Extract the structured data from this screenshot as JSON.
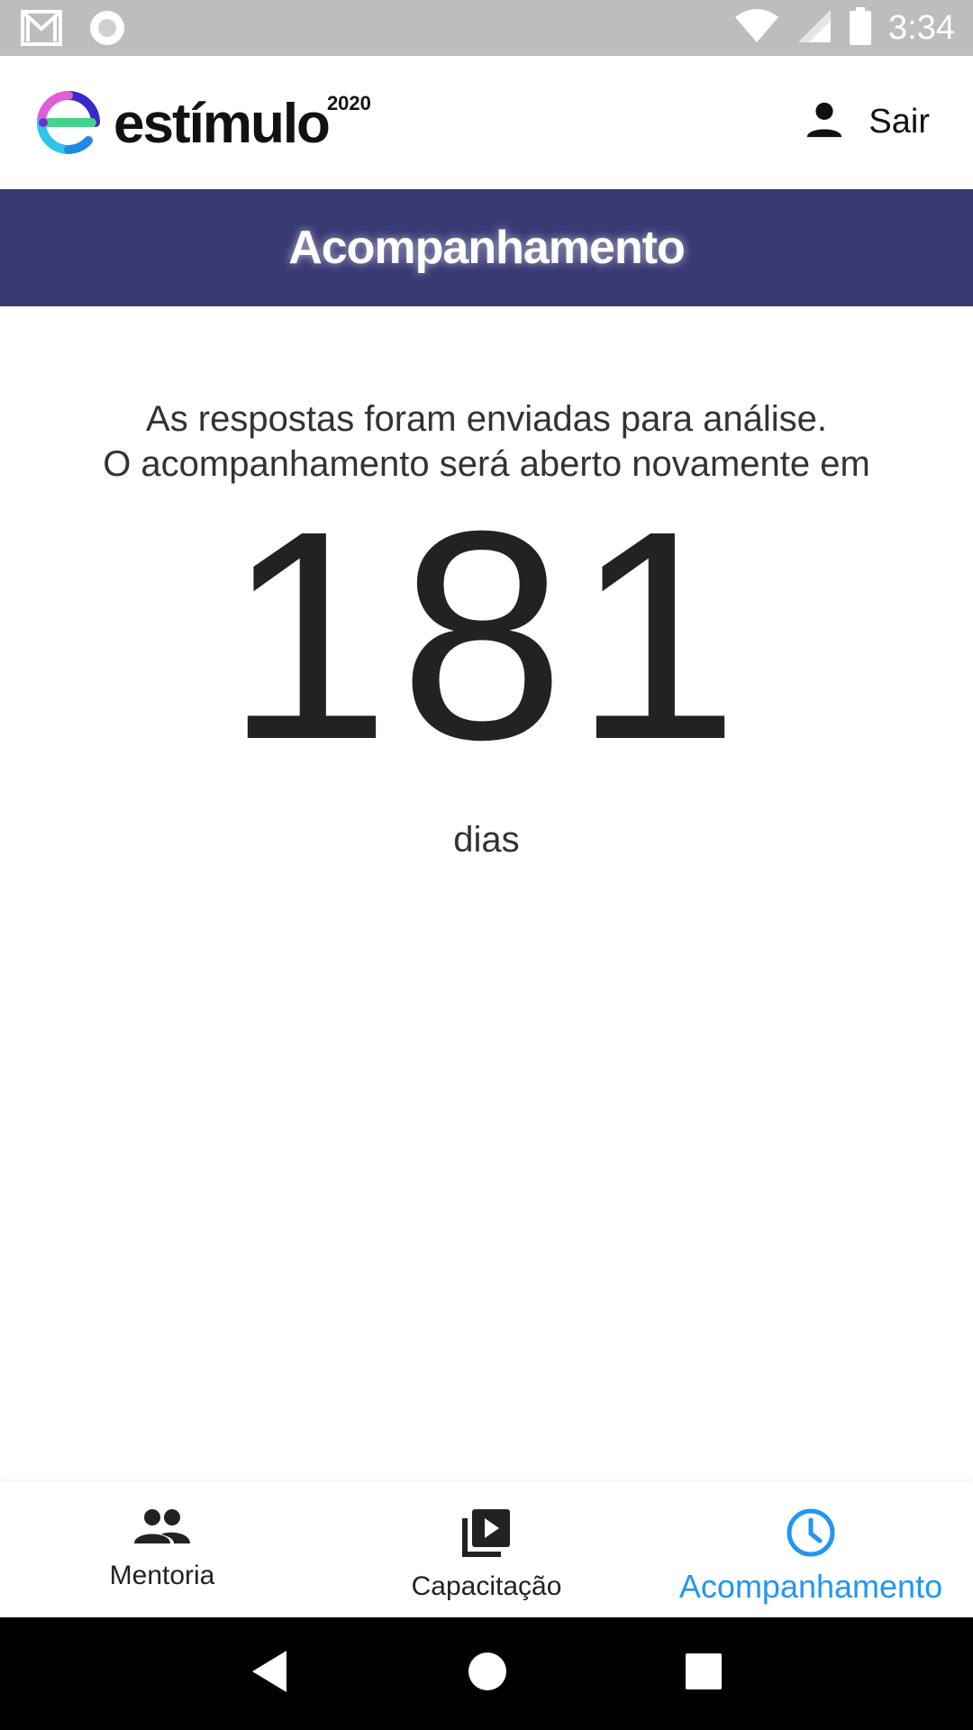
{
  "status_bar": {
    "time": "3:34",
    "icons": [
      "gmail-icon",
      "record-icon",
      "wifi-icon",
      "signal-icon",
      "battery-icon"
    ]
  },
  "header": {
    "logo_text": "estímulo",
    "logo_year": "2020",
    "logout_label": "Sair",
    "user_icon": "person-icon"
  },
  "banner": {
    "title": "Acompanhamento",
    "color": "#383a75"
  },
  "main": {
    "message_line1": "As respostas foram enviadas para análise.",
    "message_line2": "O acompanhamento será aberto novamente em",
    "countdown": "181",
    "unit": "dias"
  },
  "bottom_nav": {
    "active_color": "#2196f3",
    "items": [
      {
        "label": "Mentoria",
        "icon": "people-icon",
        "active": false
      },
      {
        "label": "Capacitação",
        "icon": "video-library-icon",
        "active": false
      },
      {
        "label": "Acompanhamento",
        "icon": "clock-icon",
        "active": true
      }
    ]
  },
  "system_nav": {
    "buttons": [
      "back-icon",
      "home-icon",
      "recents-icon"
    ]
  }
}
